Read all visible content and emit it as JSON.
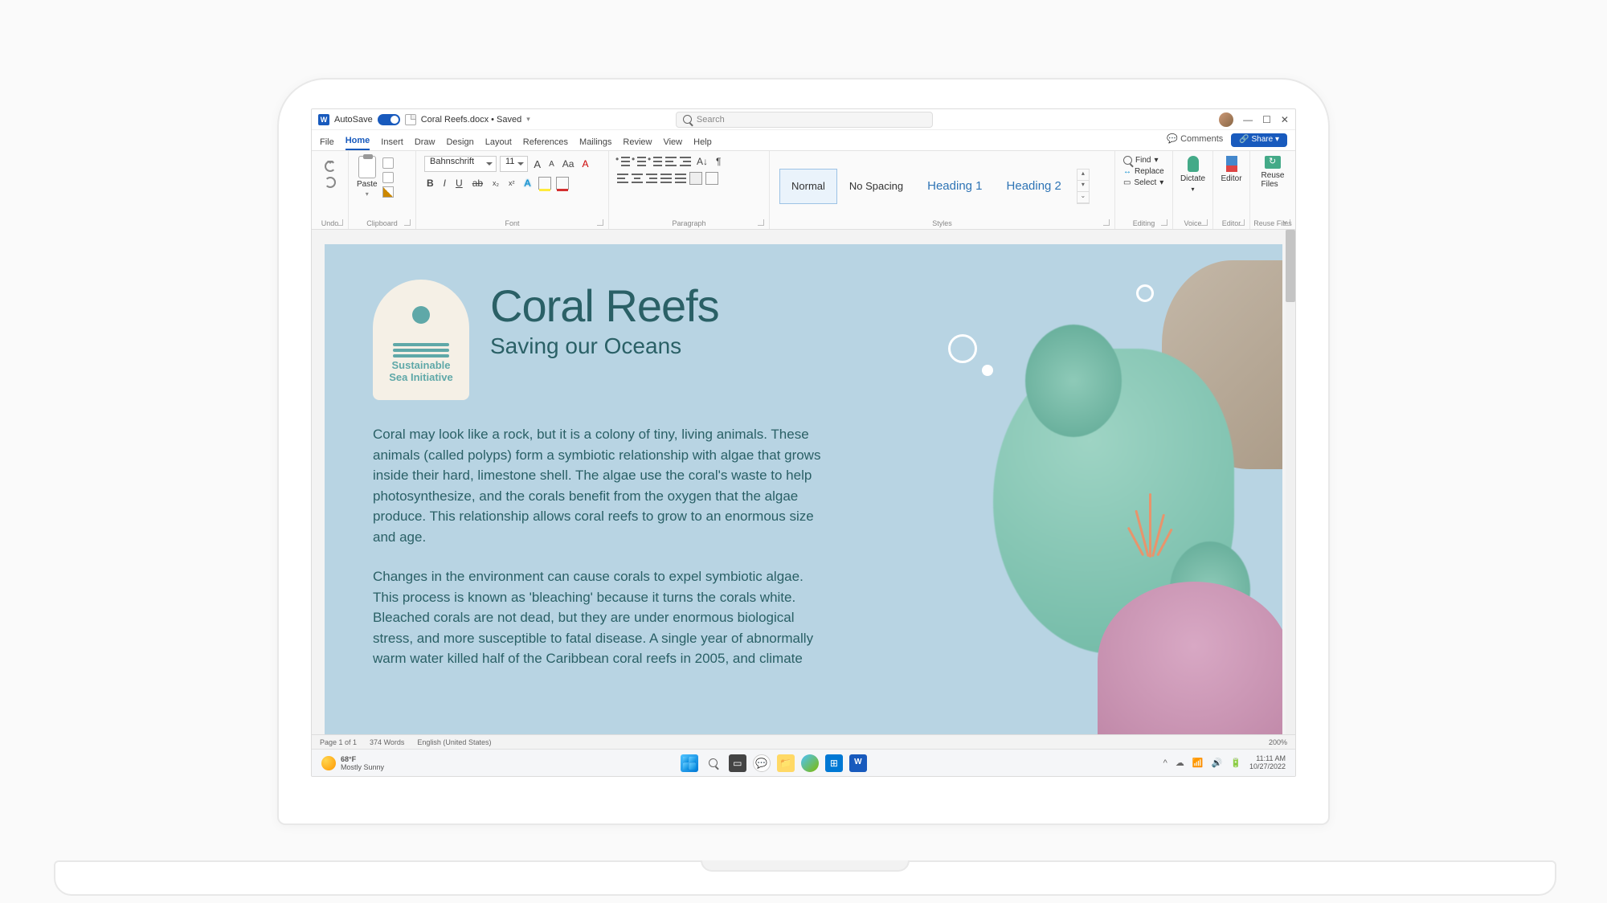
{
  "titlebar": {
    "autosave": "AutoSave",
    "autosave_on": "On",
    "doc_name": "Coral Reefs.docx • Saved",
    "search_placeholder": "Search"
  },
  "tabs": {
    "items": [
      "File",
      "Home",
      "Insert",
      "Draw",
      "Design",
      "Layout",
      "References",
      "Mailings",
      "Review",
      "View",
      "Help"
    ],
    "active": "Home",
    "comments": "Comments",
    "share": "Share"
  },
  "ribbon": {
    "undo": "Undo",
    "clipboard": {
      "paste": "Paste",
      "label": "Clipboard"
    },
    "font": {
      "name": "Bahnschrift",
      "size": "11",
      "inc": "A",
      "dec": "A",
      "case": "Aa",
      "clear": "A",
      "b": "B",
      "i": "I",
      "u": "U",
      "s": "ab",
      "sub": "x₂",
      "sup": "x²",
      "texteffects": "A",
      "highlight": "A",
      "color": "A",
      "label": "Font"
    },
    "para": {
      "label": "Paragraph"
    },
    "styles": {
      "items": [
        {
          "name": "Normal",
          "h": false
        },
        {
          "name": "No Spacing",
          "h": false
        },
        {
          "name": "Heading 1",
          "h": true
        },
        {
          "name": "Heading 2",
          "h": true
        }
      ],
      "label": "Styles"
    },
    "editing": {
      "find": "Find",
      "replace": "Replace",
      "select": "Select",
      "label": "Editing"
    },
    "voice": {
      "dictate": "Dictate",
      "label": "Voice"
    },
    "editor": {
      "editor": "Editor",
      "label": "Editor"
    },
    "reuse": {
      "reuse": "Reuse Files",
      "label": "Reuse Files"
    }
  },
  "document": {
    "logo_line1": "Sustainable",
    "logo_line2": "Sea Initiative",
    "title": "Coral Reefs",
    "subtitle": "Saving our Oceans",
    "p1": "Coral may look like a rock, but it is a colony of tiny, living animals. These animals (called polyps) form a symbiotic relationship with algae that grows inside their hard, limestone shell. The algae use the coral's waste to help photosynthesize, and the corals benefit from the oxygen that the algae produce. This relationship allows coral reefs to grow to an enormous size and age.",
    "p2": "Changes in the environment can cause corals to expel symbiotic algae. This process is known as 'bleaching' because it turns the corals white. Bleached corals are not dead, but they are under enormous biological stress, and more susceptible to fatal disease. A single year of abnormally warm water killed half of the Caribbean coral reefs in 2005, and climate"
  },
  "status": {
    "page": "Page 1 of 1",
    "words": "374 Words",
    "lang": "English (United States)",
    "zoom": "200%"
  },
  "taskbar": {
    "temp": "68°F",
    "cond": "Mostly Sunny",
    "time": "11:11 AM",
    "date": "10/27/2022"
  }
}
